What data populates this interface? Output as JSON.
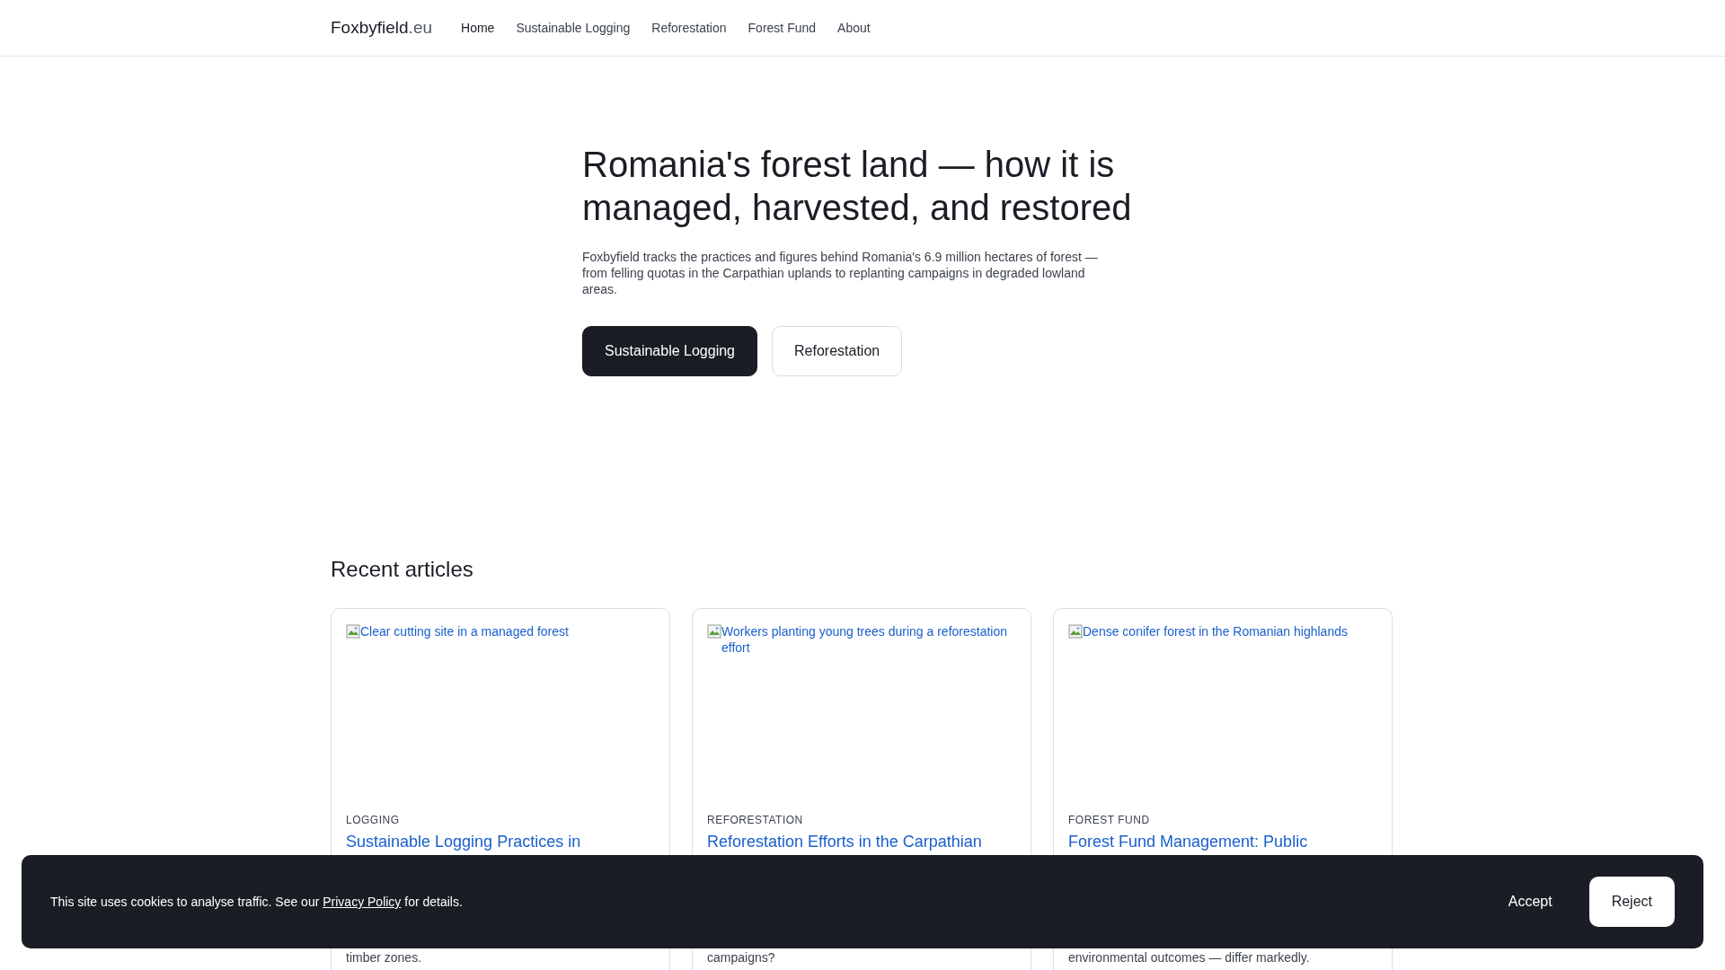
{
  "header": {
    "brand": "Foxbyfield",
    "brand_suffix": ".eu",
    "nav": [
      {
        "label": "Home",
        "selected": true
      },
      {
        "label": "Sustainable Logging",
        "selected": false
      },
      {
        "label": "Reforestation",
        "selected": false
      },
      {
        "label": "Forest Fund",
        "selected": false
      },
      {
        "label": "About",
        "selected": false
      }
    ]
  },
  "hero": {
    "title": "Romania's forest land — how it is managed, harvested, and restored",
    "intro": "Foxbyfield tracks the practices and figures behind Romania's 6.9 million hectares of forest — from felling quotas in the Carpathian uplands to replanting campaigns in degraded lowland areas.",
    "buttons": [
      {
        "label": "Sustainable Logging",
        "kind": "primary"
      },
      {
        "label": "Reforestation",
        "kind": "secondary"
      }
    ]
  },
  "articles": {
    "heading": "Recent articles",
    "cards": [
      {
        "image_alt": "Clear cutting site in a managed forest",
        "category": "LOGGING",
        "title": "Sustainable Logging Practices in",
        "summary": "timber zones."
      },
      {
        "image_alt": "Workers planting young trees during a reforestation effort",
        "category": "REFORESTATION",
        "title": "Reforestation Efforts in the Carpathian",
        "summary": "campaigns?"
      },
      {
        "image_alt": "Dense conifer forest in the Romanian highlands",
        "category": "FOREST FUND",
        "title": "Forest Fund Management: Public",
        "summary": "environmental outcomes — differ markedly."
      }
    ]
  },
  "cookie_banner": {
    "text": "This site uses cookies to analyse traffic. See our ",
    "link": "Privacy Policy",
    "text_after": " for details.",
    "buttons": [
      {
        "label": "Accept",
        "kind": "plain"
      },
      {
        "label": "Reject",
        "kind": "light"
      }
    ]
  }
}
